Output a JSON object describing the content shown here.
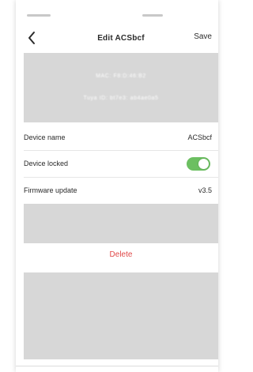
{
  "nav": {
    "title": "Edit ACSbcf",
    "save_label": "Save",
    "back_icon": "chevron-left-icon"
  },
  "info": {
    "line1": "MAC: F8:D:46:B2",
    "line2": "Tuya ID: bt7e3: ab4ae0a5"
  },
  "rows": [
    {
      "label": "Device name",
      "value": "ACSbcf"
    },
    {
      "label": "Device locked",
      "toggle_on": true
    },
    {
      "label": "Firmware update",
      "value": "v3.5"
    }
  ],
  "actions": {
    "delete_label": "Delete"
  },
  "colors": {
    "toggle_on": "#6cbf61",
    "delete": "#e04848",
    "panel": "#d7d7d7"
  }
}
